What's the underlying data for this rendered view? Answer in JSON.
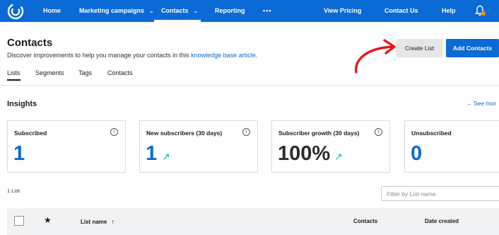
{
  "nav": {
    "items": [
      {
        "label": "Home"
      },
      {
        "label": "Marketing campaigns"
      },
      {
        "label": "Contacts"
      },
      {
        "label": "Reporting"
      },
      {
        "label": "•••"
      },
      {
        "label": "View Pricing"
      },
      {
        "label": "Contact Us"
      },
      {
        "label": "Help"
      }
    ],
    "active": "Contacts",
    "logo_icon": "constant-contact-logo-icon",
    "notification_icon": "bell-icon"
  },
  "header": {
    "title": "Contacts",
    "subtitle_text": "Discover improvements to help you manage your contacts in this",
    "subtitle_link": "knowledge base article",
    "subtitle_end": "."
  },
  "actions": {
    "create_list": "Create List",
    "add_contacts": "Add Contacts"
  },
  "tabs": [
    {
      "label": "Lists"
    },
    {
      "label": "Segments"
    },
    {
      "label": "Tags"
    },
    {
      "label": "Contacts"
    }
  ],
  "insights": {
    "title": "Insights",
    "see_more": "→ See mor",
    "cards": [
      {
        "title": "Subscribed",
        "value": "1",
        "trend": ""
      },
      {
        "title": "New subscribers (30 days)",
        "value": "1",
        "trend": "↗"
      },
      {
        "title": "Subscriber growth (30 days)",
        "value": "100%",
        "trend": "↗"
      },
      {
        "title": "Unsubscribed",
        "value": "0",
        "trend": ""
      }
    ],
    "info_icon": "info-icon"
  },
  "lists": {
    "count": "1 List",
    "filter_placeholder": "Filter by List name",
    "columns": [
      {
        "label": "List name",
        "sort": "↑"
      },
      {
        "label": "Contacts"
      },
      {
        "label": "Date created"
      }
    ],
    "star_icon": "★"
  },
  "colors": {
    "brand_blue": "#0a6ad6",
    "annotation_red": "#e01b24",
    "trend_teal": "#1fb2a6",
    "notification_orange": "#f08b1d"
  }
}
